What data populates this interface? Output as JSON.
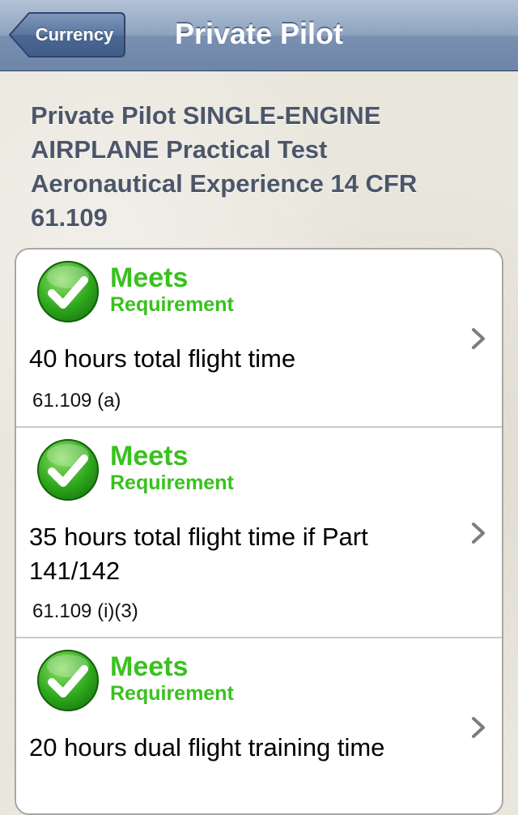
{
  "navbar": {
    "back_label": "Currency",
    "title": "Private Pilot"
  },
  "section_header": "Private Pilot SINGLE-ENGINE AIRPLANE Practical Test Aeronautical Experience 14 CFR 61.109",
  "requirements": [
    {
      "status_title": "Meets",
      "status_sub": "Requirement",
      "title": "40 hours total flight time",
      "reference": "61.109 (a)",
      "icon": "check-circle-icon"
    },
    {
      "status_title": "Meets",
      "status_sub": "Requirement",
      "title": "35 hours total flight time if Part 141/142",
      "reference": "61.109 (i)(3)",
      "icon": "check-circle-icon"
    },
    {
      "status_title": "Meets",
      "status_sub": "Requirement",
      "title": "20 hours dual flight training time",
      "reference": "",
      "icon": "check-circle-icon"
    }
  ],
  "colors": {
    "status_green": "#39c11e",
    "navbar": "#7990b1",
    "header_text": "#4c566a"
  }
}
